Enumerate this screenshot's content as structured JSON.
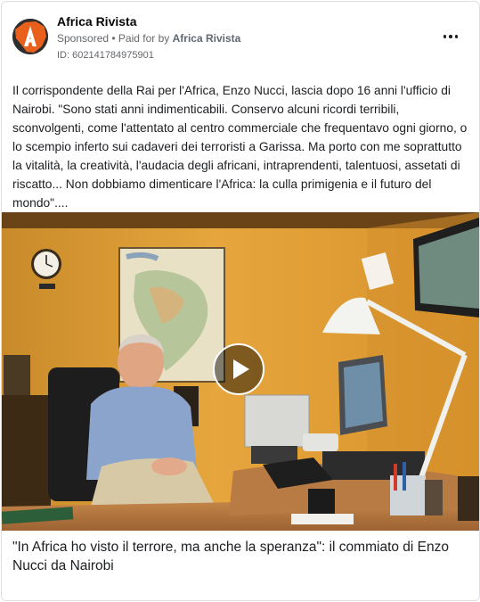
{
  "post": {
    "page_name": "Africa Rivista",
    "sponsored_label": "Sponsored",
    "paid_for_prefix": "Paid for by",
    "paid_for_name": "Africa Rivista",
    "ad_id": "ID: 602141784975901",
    "body": "Il corrispondente della Rai per l'Africa, Enzo Nucci, lascia dopo 16 anni l'ufficio di Nairobi. \"Sono stati anni indimenticabili. Conservo alcuni ricordi terribili, sconvolgenti, come l'attentato al centro commerciale che frequentavo ogni giorno, o lo scempio inferto sui cadaveri dei terroristi a Garissa. Ma porto con me soprattutto la vitalità, la creatività, l'audacia degli africani, intraprendenti, talentuosi, assetati di riscatto... Non dobbiamo dimenticare l'Africa: la culla primigenia e il futuro del mondo\"....",
    "caption": "\"In Africa ho visto il terrore, ma anche la speranza\": il commiato di Enzo Nucci da Nairobi"
  },
  "icons": {
    "avatar": "africa-rivista-logo-icon",
    "more": "more-options-icon",
    "play": "play-icon"
  },
  "colors": {
    "logo_orange": "#e8601c",
    "wall": "#e2a23a",
    "text": "#1c1e21",
    "meta": "#65676b"
  }
}
